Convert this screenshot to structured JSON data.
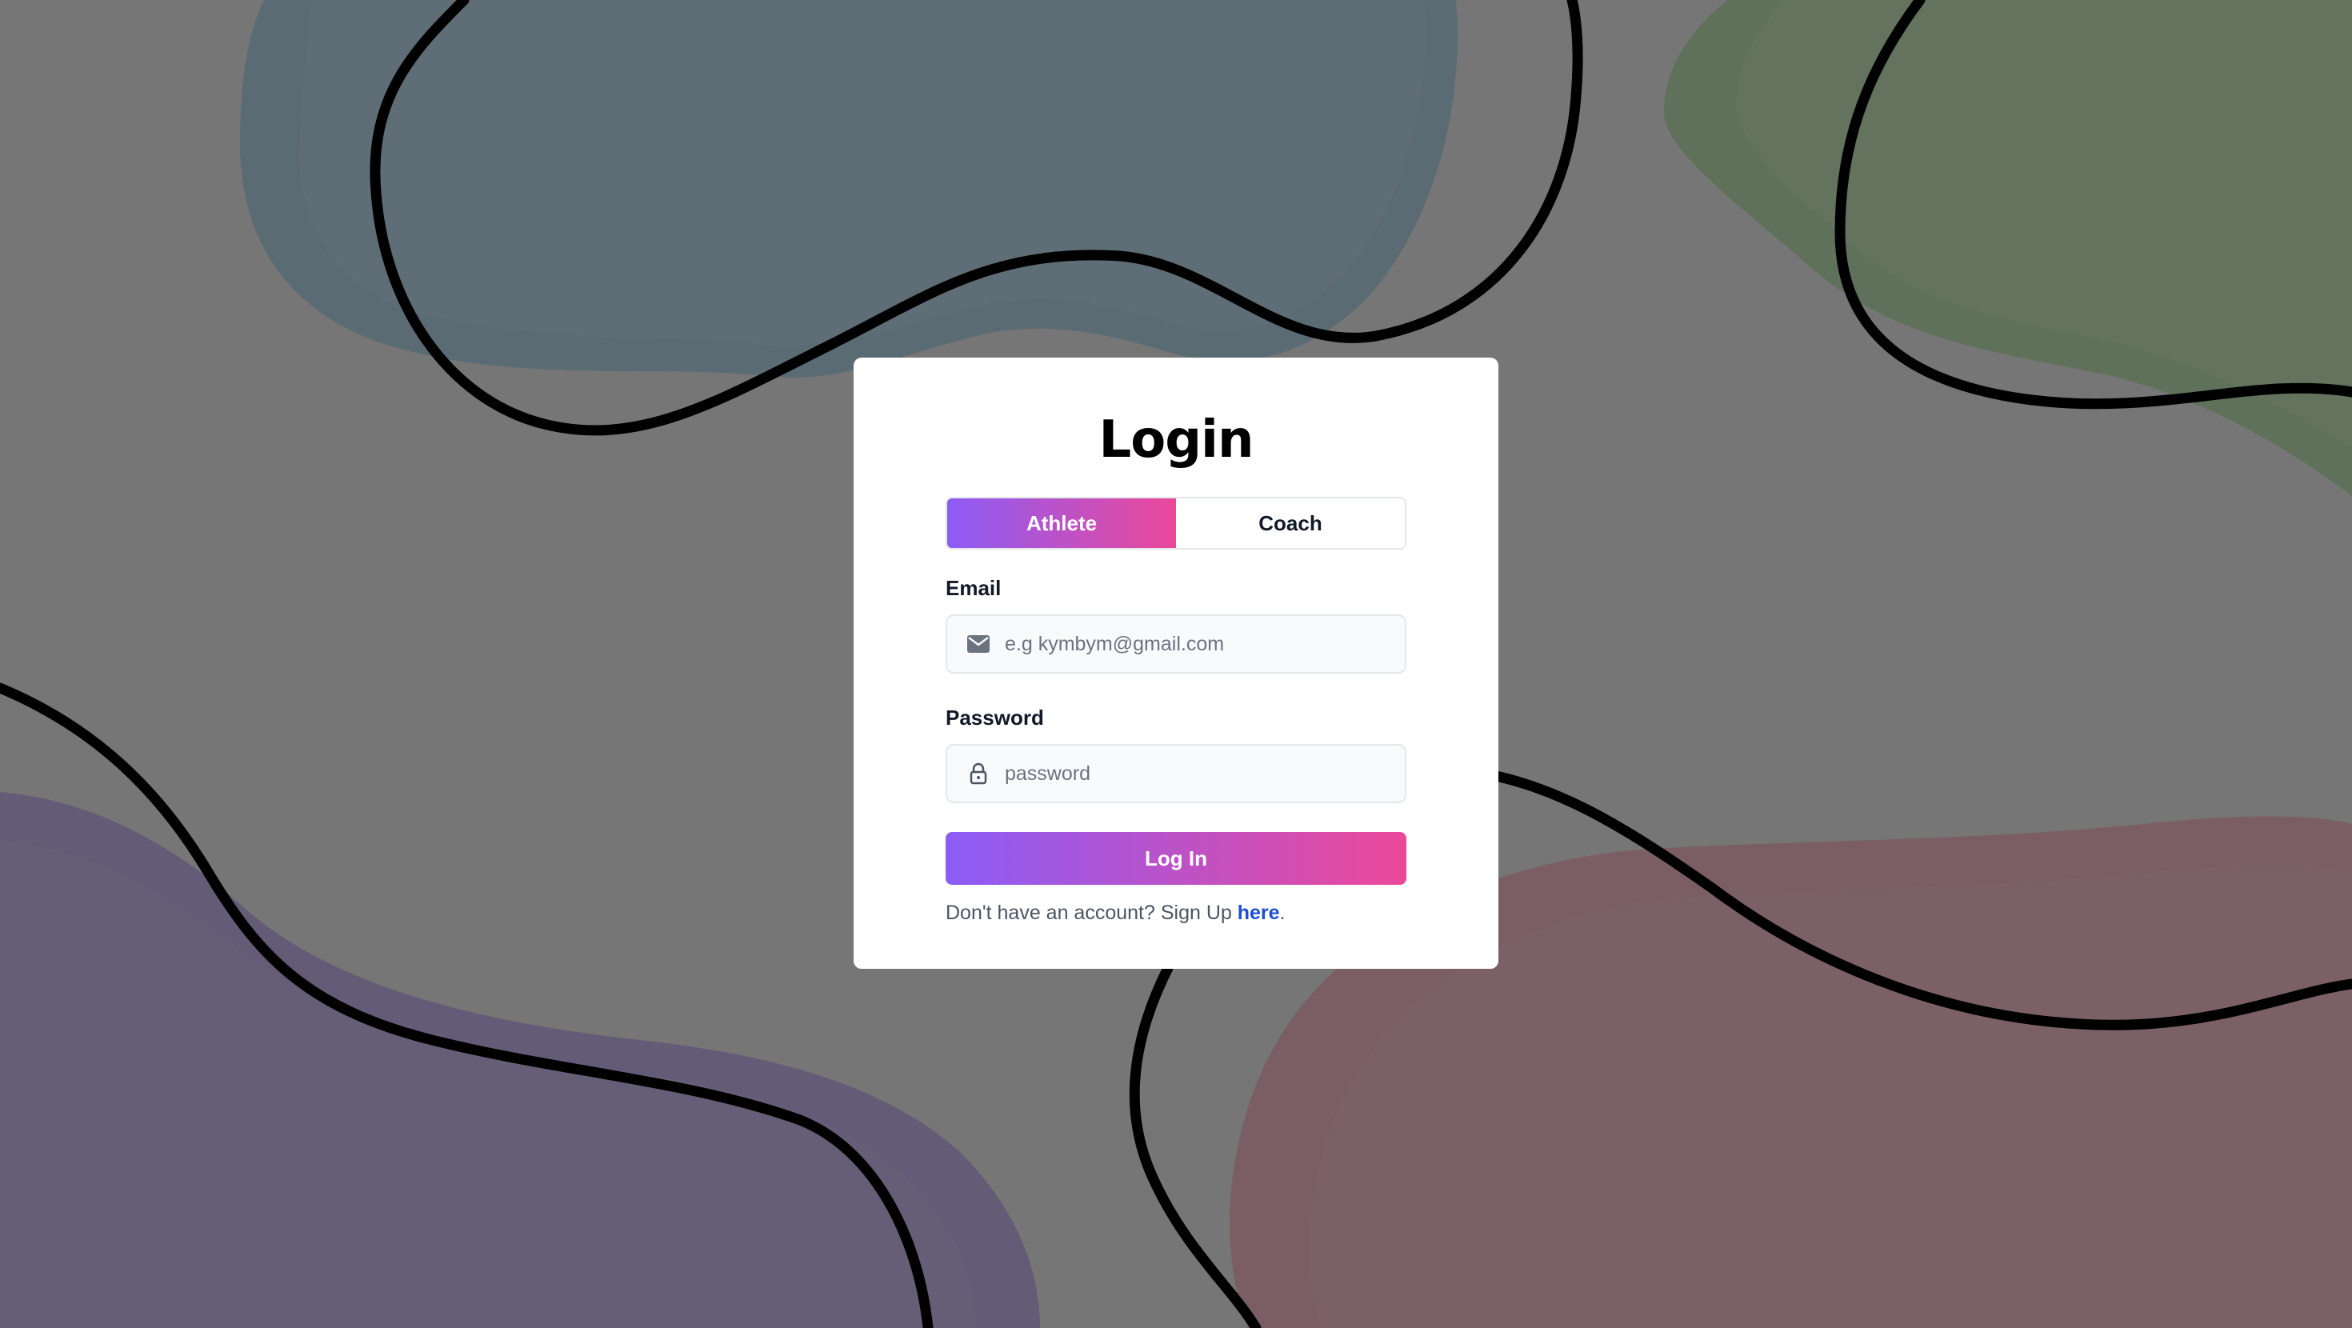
{
  "login": {
    "title": "Login",
    "roles": [
      {
        "label": "Athlete",
        "selected": true
      },
      {
        "label": "Coach",
        "selected": false
      }
    ],
    "email": {
      "label": "Email",
      "placeholder": "e.g kymbym@gmail.com",
      "value": "",
      "icon": "mail-icon"
    },
    "password": {
      "label": "Password",
      "placeholder": "password",
      "value": "",
      "icon": "lock-icon"
    },
    "submit_label": "Log In",
    "signup": {
      "prompt": "Don't have an account? Sign Up ",
      "link_label": "here",
      "suffix": "."
    }
  },
  "theme": {
    "gradient_start": "#8b5cf6",
    "gradient_end": "#ec4899",
    "link_color": "#1d4ed8",
    "blob_colors": [
      "#5aa6cc",
      "#6cc05a",
      "#9b7ad6",
      "#e07a92"
    ]
  }
}
